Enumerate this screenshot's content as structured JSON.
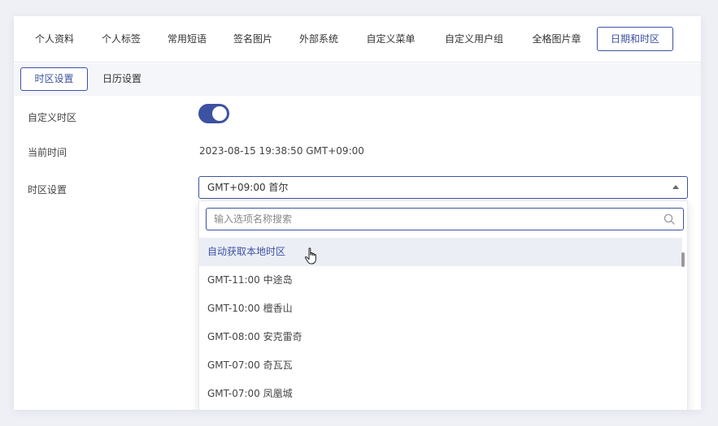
{
  "top_tabs": [
    "个人资料",
    "个人标签",
    "常用短语",
    "签名图片",
    "外部系统",
    "自定义菜单",
    "自定义用户组",
    "全格图片章",
    "日期和时区"
  ],
  "sub_tabs": [
    "时区设置",
    "日历设置"
  ],
  "form": {
    "custom_tz_label": "自定义时区",
    "custom_tz_enabled": true,
    "current_time_label": "当前时间",
    "current_time_value": "2023-08-15 19:38:50 GMT+09:00",
    "tz_setting_label": "时区设置",
    "tz_selected": "GMT+09:00 首尔"
  },
  "dropdown": {
    "search_placeholder": "输入选项名称搜索",
    "options": [
      "自动获取本地时区",
      "GMT-11:00 中途岛",
      "GMT-10:00 檀香山",
      "GMT-08:00 安克雷奇",
      "GMT-07:00 奇瓦瓦",
      "GMT-07:00 凤凰城"
    ],
    "hovered_index": 0
  },
  "colors": {
    "accent": "#3d52a1",
    "hover_bg": "#eceef6",
    "subtab_bg": "#f5f6fa"
  },
  "icons": {
    "search": "search-icon",
    "caret": "caret-up-icon",
    "cursor": "hand-pointer-icon"
  }
}
